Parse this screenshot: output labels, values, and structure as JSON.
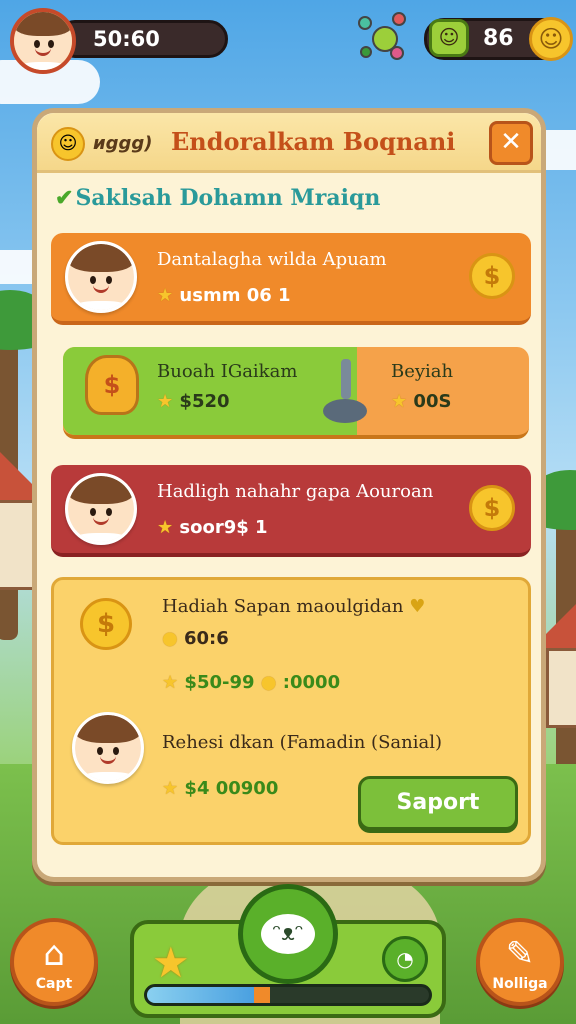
{
  "hud": {
    "timer": "50:60",
    "coins": "86",
    "coin_face_icon": "smile-coin-icon"
  },
  "panel": {
    "header_prefix": "иggg)",
    "title": "Endoralkam Boqnani",
    "close_label": "✕",
    "subtitle": "Saklsah Dohamn Mraiqn"
  },
  "rows": [
    {
      "title": "Dantalagha wilda Apuam",
      "sub": "usmm 06 1",
      "coin": "$"
    },
    {
      "left_title": "Buoah IGaikam",
      "left_value": "$520",
      "right_title": "Beyiah",
      "right_value": "00S"
    },
    {
      "title": "Hadligh nahahr gapa Aouroan",
      "sub": "soor9$ 1",
      "coin": "$"
    }
  ],
  "reward": {
    "title": "Hadiah Sapan maoulgidan",
    "amount": "60:6",
    "range": "$50-99",
    "bonus": ":0000",
    "second_title": "Rehesi dkan (Famadin (Sanial)",
    "second_value": "$4 00900",
    "support_label": "Saport"
  },
  "bottom": {
    "left_label": "Capt",
    "right_label": "Nolliga",
    "progress_percent": 38
  },
  "colors": {
    "orange": "#f08a2a",
    "red": "#b83a3a",
    "green": "#8acb3a",
    "gold": "#f7c52c"
  }
}
